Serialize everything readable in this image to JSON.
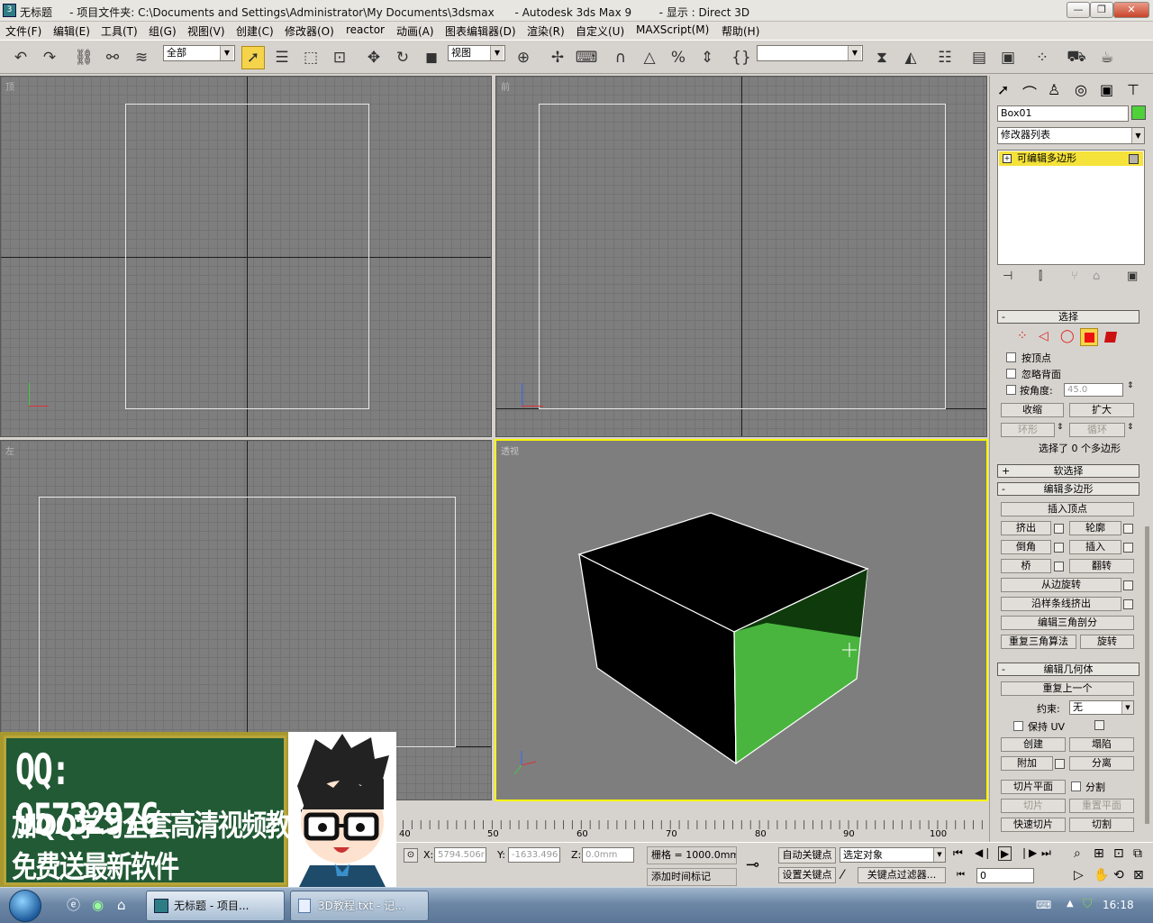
{
  "window": {
    "app_icon": "3dsmax-icon",
    "title_name": "无标题",
    "title_rest": "     - 项目文件夹: C:\\Documents and Settings\\Administrator\\My Documents\\3dsmax      - Autodesk 3ds Max 9        - 显示 : Direct 3D",
    "minimize_label": "—",
    "maximize_label": "❐",
    "close_label": "✕"
  },
  "menu": [
    "文件(F)",
    "编辑(E)",
    "工具(T)",
    "组(G)",
    "视图(V)",
    "创建(C)",
    "修改器(O)",
    "reactor",
    "动画(A)",
    "图表编辑器(D)",
    "渲染(R)",
    "自定义(U)",
    "MAXScript(M)",
    "帮助(H)"
  ],
  "toolbar": {
    "selection_filter": "全部",
    "reference_coord": "视图",
    "named_selection": ""
  },
  "viewports": {
    "top": "顶",
    "front": "前",
    "left": "左",
    "perspective": "透视"
  },
  "command_panel": {
    "object_name": "Box01",
    "object_color": "#4fd13a",
    "modifier_list": "修改器列表",
    "stack_item": "可编辑多边形",
    "select_rollout": "选择",
    "by_vertex": "按顶点",
    "ignore_backfacing": "忽略背面",
    "by_angle": "按角度:",
    "angle_value": "45.0",
    "shrink": "收缩",
    "grow": "扩大",
    "ring": "环形",
    "loop": "循环",
    "selection_info": "选择了 0 个多边形",
    "soft_selection": "软选择",
    "edit_polygons": "编辑多边形",
    "insert_vertex": "插入顶点",
    "extrude": "挤出",
    "outline": "轮廓",
    "bevel": "倒角",
    "inset": "插入",
    "bridge": "桥",
    "flip": "翻转",
    "hinge_from_edge": "从边旋转",
    "extrude_along_spline": "沿样条线挤出",
    "edit_triangulation": "编辑三角剖分",
    "retriangulate": "重复三角算法",
    "turn": "旋转",
    "edit_geometry": "编辑几何体",
    "repeat_last": "重复上一个",
    "constraints_label": "约束:",
    "constraints_value": "无",
    "preserve_uvs": "保持 UV",
    "create": "创建",
    "collapse": "塌陷",
    "attach": "附加",
    "detach": "分离",
    "slice_plane": "切片平面",
    "split": "分割",
    "slice": "切片",
    "reset_plane": "重置平面",
    "quickslice": "快速切片",
    "cut": "切割"
  },
  "timeline": {
    "ticks": [
      "40",
      "50",
      "60",
      "70",
      "80",
      "90",
      "100"
    ]
  },
  "status": {
    "x_label": "X:",
    "x_value": "5794.506r",
    "y_label": "Y:",
    "y_value": "-1633.496",
    "z_label": "Z:",
    "z_value": "0.0mm",
    "grid_label": "栅格 = 1000.0mm",
    "add_time_tag": "添加时间标记",
    "auto_key": "自动关键点",
    "set_key": "设置关键点",
    "key_mode": "选定对象",
    "key_filters": "关键点过滤器...",
    "frame": "0"
  },
  "promo": {
    "qq": "QQ: 95732976",
    "line1": "加QQ学习全套高清视频教程",
    "line2": "免费送最新软件"
  },
  "taskbar": {
    "task1": "无标题    - 项目...",
    "task2": "3D教程.txt - 记...",
    "clock": "16:18"
  }
}
